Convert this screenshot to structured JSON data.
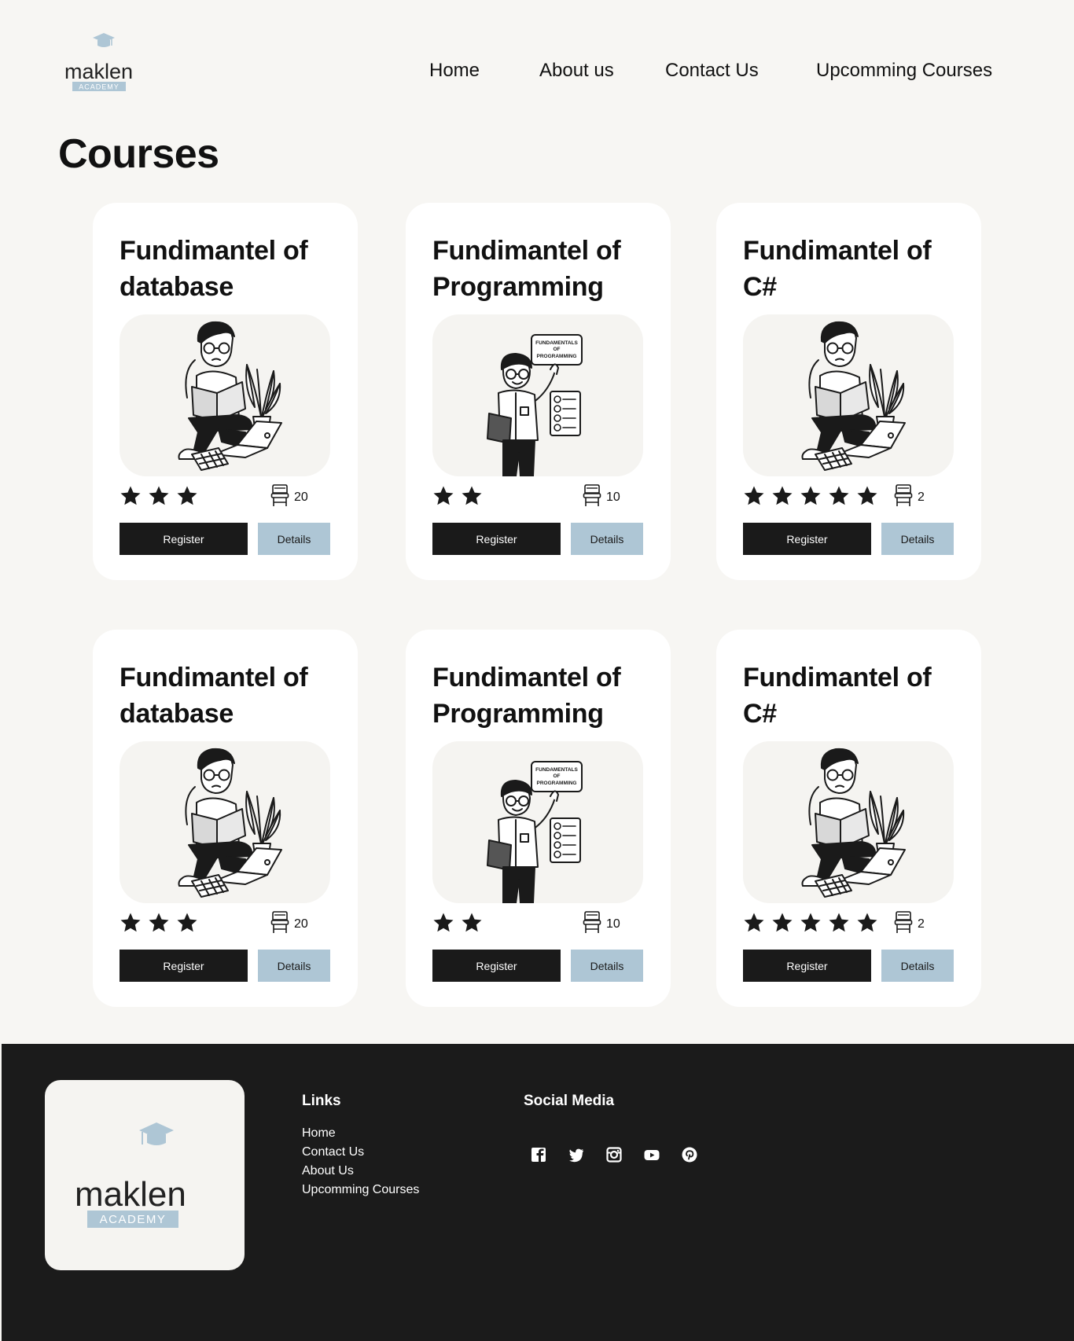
{
  "brand": {
    "name": "maklen",
    "tagline": "ACADEMY",
    "accent": "#aec6d5",
    "dark": "#1a1a1a"
  },
  "nav": {
    "home": "Home",
    "about": "About us",
    "contact": "Contact Us",
    "upcoming": "Upcomming Courses"
  },
  "page": {
    "title": "Courses"
  },
  "courses": [
    {
      "title": "Fundimantel of database",
      "illustration": "student-reading-icon",
      "rating": 3,
      "seats": "20",
      "register": "Register",
      "details": "Details"
    },
    {
      "title": "Fundimantel of Programming",
      "illustration": "teacher-presenting-icon",
      "rating": 2,
      "seats": "10",
      "register": "Register",
      "details": "Details",
      "sign": [
        "FUNDAMENTALS",
        "OF",
        "PROGRAMMING"
      ]
    },
    {
      "title": "Fundimantel of C#",
      "illustration": "student-reading-icon",
      "rating": 5,
      "seats": "2",
      "register": "Register",
      "details": "Details"
    },
    {
      "title": "Fundimantel of database",
      "illustration": "student-reading-icon",
      "rating": 3,
      "seats": "20",
      "register": "Register",
      "details": "Details"
    },
    {
      "title": "Fundimantel of Programming",
      "illustration": "teacher-presenting-icon",
      "rating": 2,
      "seats": "10",
      "register": "Register",
      "details": "Details",
      "sign": [
        "FUNDAMENTALS",
        "OF",
        "PROGRAMMING"
      ]
    },
    {
      "title": "Fundimantel of C#",
      "illustration": "student-reading-icon",
      "rating": 5,
      "seats": "2",
      "register": "Register",
      "details": "Details"
    }
  ],
  "footer": {
    "links_heading": "Links",
    "links": [
      "Home",
      "Contact Us",
      "About Us",
      "Upcomming Courses"
    ],
    "social_heading": "Social Media",
    "social": [
      "facebook-icon",
      "twitter-icon",
      "instagram-icon",
      "youtube-icon",
      "pinterest-icon"
    ]
  }
}
